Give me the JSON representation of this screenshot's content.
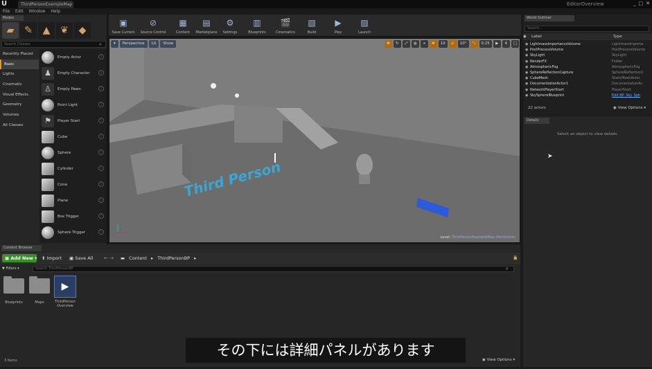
{
  "window": {
    "doc_tab": "ThirdPersonExampleMap",
    "editor_overview": "EditorOverview",
    "controls": [
      "_",
      "□",
      "✕"
    ]
  },
  "menu": [
    "File",
    "Edit",
    "Window",
    "Help"
  ],
  "modes": {
    "tab_label": "Modes",
    "search_placeholder": "Search Classes",
    "categories": [
      "Recently Placed",
      "Basic",
      "Lights",
      "Cinematic",
      "Visual Effects",
      "Geometry",
      "Volumes",
      "All Classes"
    ],
    "selected_category": "Basic",
    "items": [
      {
        "label": "Empty Actor",
        "thumb": "sphere"
      },
      {
        "label": "Empty Character",
        "thumb": "figure"
      },
      {
        "label": "Empty Pawn",
        "thumb": "figure"
      },
      {
        "label": "Point Light",
        "thumb": "sphere"
      },
      {
        "label": "Player Start",
        "thumb": "figure"
      },
      {
        "label": "Cube",
        "thumb": "sq"
      },
      {
        "label": "Sphere",
        "thumb": "sphere"
      },
      {
        "label": "Cylinder",
        "thumb": "sq"
      },
      {
        "label": "Cone",
        "thumb": "sq"
      },
      {
        "label": "Plane",
        "thumb": "sq"
      },
      {
        "label": "Box Trigger",
        "thumb": "sq"
      },
      {
        "label": "Sphere Trigger",
        "thumb": "sphere"
      }
    ]
  },
  "toolbar": {
    "buttons": [
      {
        "label": "Save Current",
        "icon": "save-icon",
        "glyph": "▣"
      },
      {
        "label": "Source Control",
        "icon": "source-control-icon",
        "glyph": "⊘"
      },
      {
        "label": "Content",
        "icon": "content-icon",
        "glyph": "▦"
      },
      {
        "label": "Marketplace",
        "icon": "marketplace-icon",
        "glyph": "▤"
      },
      {
        "label": "Settings",
        "icon": "settings-icon",
        "glyph": "⚙"
      },
      {
        "label": "Blueprints",
        "icon": "blueprints-icon",
        "glyph": "▥"
      },
      {
        "label": "Cinematics",
        "icon": "cinematics-icon",
        "glyph": "🎬"
      },
      {
        "label": "Build",
        "icon": "build-icon",
        "glyph": "▧"
      },
      {
        "label": "Play",
        "icon": "play-icon",
        "glyph": "▶"
      },
      {
        "label": "Launch",
        "icon": "launch-icon",
        "glyph": "▨"
      }
    ]
  },
  "viewport": {
    "perspective": "Perspective",
    "lit": "Lit",
    "show": "Show",
    "grid_value": "10",
    "rot_value": "10°",
    "scale_value": "0.25",
    "cam_speed": "4",
    "level_prefix": "Level:",
    "level_name": "ThirdPersonExampleMap (Persistent)",
    "floor_text": "Third Person"
  },
  "content_browser": {
    "tab_label": "Content Browser",
    "add_new": "Add New",
    "import": "Import",
    "save_all": "Save All",
    "path": [
      "Content",
      "ThirdPersonBP"
    ],
    "filters": "Filters",
    "search_placeholder": "Search ThirdPersonBP",
    "assets": [
      {
        "label": "Blueprints",
        "kind": "folder"
      },
      {
        "label": "Maps",
        "kind": "folder"
      },
      {
        "label": "ThirdPerson Overview",
        "kind": "asset"
      }
    ],
    "items_count": "3 items",
    "view_options": "View Options"
  },
  "subtitle": "その下には詳細パネルがあります",
  "world_outliner": {
    "tab_label": "World Outliner",
    "search_placeholder": "Search...",
    "col_label": "Label",
    "col_type": "Type",
    "rows": [
      {
        "label": "LightmassImportanceVolume",
        "type": "LightmassImporta"
      },
      {
        "label": "PostProcessVolume",
        "type": "PostProcessVolume"
      },
      {
        "label": "SkyLight",
        "type": "SkyLight"
      },
      {
        "label": "RenderFX",
        "type": "Folder"
      },
      {
        "label": "AtmosphericFog",
        "type": "AtmosphericFog"
      },
      {
        "label": "SphereReflectionCapture",
        "type": "SphereReflectionC"
      },
      {
        "label": "CubeMesh",
        "type": "StaticMeshActor"
      },
      {
        "label": "DocumentationActor1",
        "type": "DocumentationAc"
      },
      {
        "label": "NetworkPlayerStart",
        "type": "PlayerStart"
      },
      {
        "label": "SkySphereBlueprint",
        "type": "Edit BP_Sky_Sph"
      }
    ],
    "count": "22 actors",
    "view_options": "View Options"
  },
  "details": {
    "tab_label": "Details",
    "empty_msg": "Select an object to view details."
  },
  "colors": {
    "accent": "#d89a2a",
    "add_new": "#3c8e2a",
    "floor_text": "#3aa6d6"
  }
}
